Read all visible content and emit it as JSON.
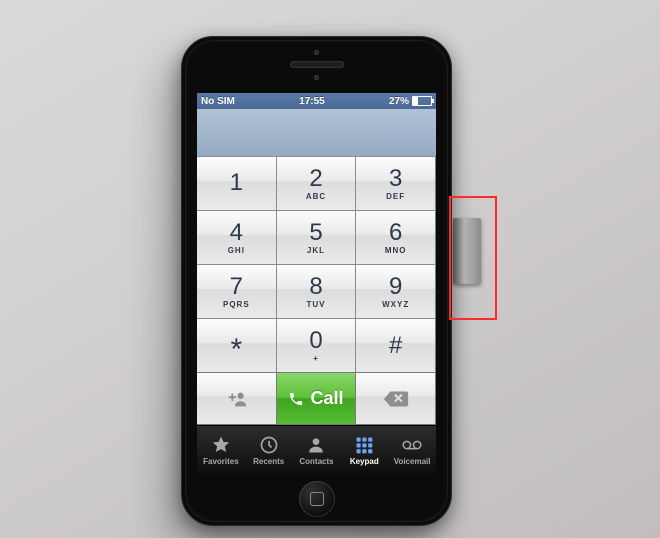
{
  "status": {
    "carrier": "No SIM",
    "time": "17:55",
    "battery_pct": "27%"
  },
  "keys": [
    {
      "num": "1",
      "sub": ""
    },
    {
      "num": "2",
      "sub": "ABC"
    },
    {
      "num": "3",
      "sub": "DEF"
    },
    {
      "num": "4",
      "sub": "GHI"
    },
    {
      "num": "5",
      "sub": "JKL"
    },
    {
      "num": "6",
      "sub": "MNO"
    },
    {
      "num": "7",
      "sub": "PQRS"
    },
    {
      "num": "8",
      "sub": "TUV"
    },
    {
      "num": "9",
      "sub": "WXYZ"
    },
    {
      "num": "*",
      "sub": ""
    },
    {
      "num": "0",
      "sub": "+"
    },
    {
      "num": "#",
      "sub": ""
    }
  ],
  "call_label": "Call",
  "tabs": [
    {
      "label": "Favorites"
    },
    {
      "label": "Recents"
    },
    {
      "label": "Contacts"
    },
    {
      "label": "Keypad"
    },
    {
      "label": "Voicemail"
    }
  ]
}
